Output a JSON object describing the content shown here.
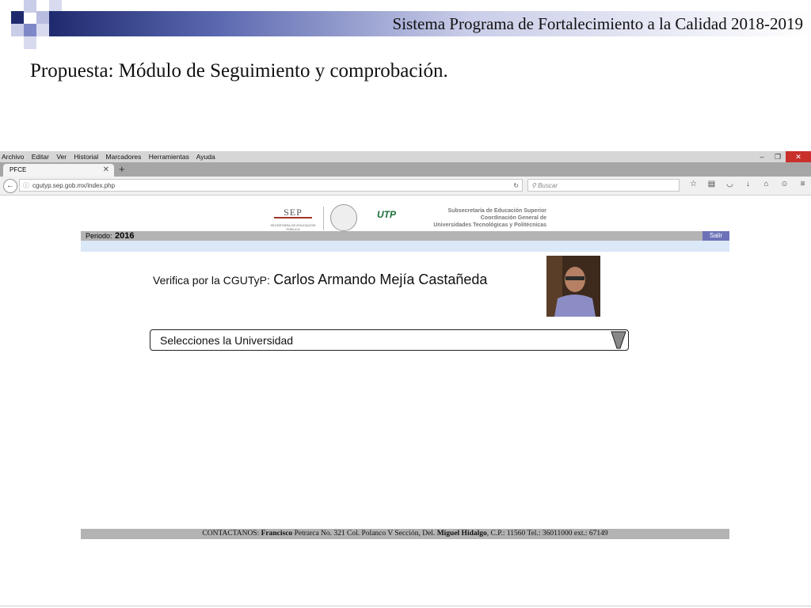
{
  "slide": {
    "header": "Sistema Programa de Fortalecimiento a la Calidad 2018-2019",
    "title": "Propuesta: Módulo de Seguimiento y comprobación.",
    "accent_color": "#1f2a6e"
  },
  "browser": {
    "menu": [
      "Archivo",
      "Editar",
      "Ver",
      "Historial",
      "Marcadores",
      "Herramientas",
      "Ayuda"
    ],
    "tab_title": "PFCE",
    "url": "cgutyp.sep.gob.mx/index.php",
    "search_placeholder": "Buscar",
    "icons": [
      "back-icon",
      "info-icon",
      "reload-icon",
      "search-icon",
      "star-icon",
      "reading-list-icon",
      "pocket-icon",
      "download-icon",
      "home-icon",
      "sync-icon",
      "menu-icon"
    ]
  },
  "page": {
    "logos": {
      "sep": "SEP",
      "sep_sub": "SECRETARÍA DE EDUCACIÓN PÚBLICA",
      "utp": "UTP",
      "subsecretaria": [
        "Subsecretaría de Educación Superior",
        "Coordinación General de",
        "Universidades Tecnológicas y Politécnicas"
      ]
    },
    "period_label": "Periodo:",
    "period_value": "2016",
    "logout": "Salir",
    "verifier_label": "Verifica por la CGUTyP:",
    "verifier_name": "Carlos Armando Mejía Castañeda",
    "university_select": "Selecciones la Universidad",
    "footer": {
      "c1": "CONTACTANOS: ",
      "c2": "Francisco",
      "c3": " Petrarca No. 321 Col. Polanco V Sección, Del. ",
      "c4": "Miguel Hidalgo",
      "c5": ", C.P.: 11560 Tel.: 36011000 ext.: 67149"
    }
  }
}
